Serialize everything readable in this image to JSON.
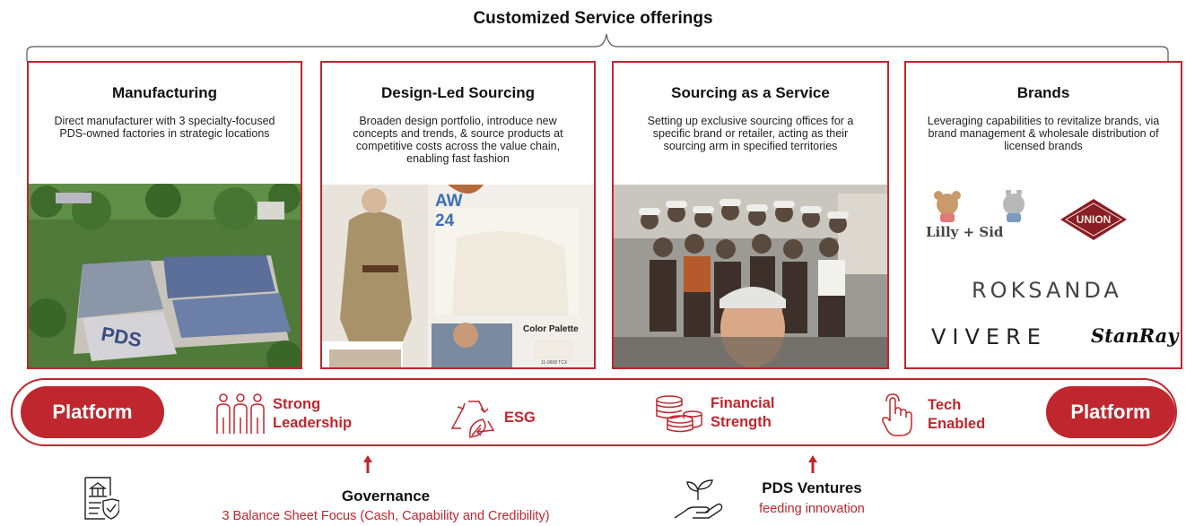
{
  "title": "Customized Service offerings",
  "cards": [
    {
      "title": "Manufacturing",
      "description": "Direct manufacturer with 3 specialty-focused PDS-owned factories in strategic locations"
    },
    {
      "title": "Design-Led Sourcing",
      "description": "Broaden design portfolio, introduce new concepts and trends, & source products at competitive costs across the value chain, enabling fast fashion",
      "photo_text": {
        "season": "AW\n24",
        "palette_label": "Color Palette",
        "palette_code": "11-0608 TCX"
      }
    },
    {
      "title": "Sourcing as a Service",
      "description": "Setting up exclusive sourcing offices for a specific brand or retailer, acting as their sourcing arm in specified territories"
    },
    {
      "title": "Brands",
      "description": "Leveraging capabilities to revitalize brands, via brand management & wholesale distribution of licensed brands",
      "brand_logos": [
        "Lilly + Sid",
        "UNION",
        "ROKSANDA",
        "VIVERE",
        "StanRay"
      ]
    }
  ],
  "platform_label_left": "Platform",
  "platform_label_right": "Platform",
  "pillars": [
    {
      "label": "Strong\nLeadership",
      "icon": "people-icon"
    },
    {
      "label": "ESG",
      "icon": "recycle-leaf-icon"
    },
    {
      "label": "Financial\nStrength",
      "icon": "coins-icon"
    },
    {
      "label": "Tech\nEnabled",
      "icon": "hand-touch-icon"
    }
  ],
  "governance": {
    "title": "Governance",
    "subtitle": "3 Balance Sheet Focus (Cash, Capability and Credibility)",
    "icon": "governance-document-icon"
  },
  "ventures": {
    "title": "PDS Ventures",
    "subtitle": "feeding innovation",
    "icon": "plant-hand-icon"
  },
  "colors": {
    "accent": "#c0262d",
    "text": "#111111"
  }
}
